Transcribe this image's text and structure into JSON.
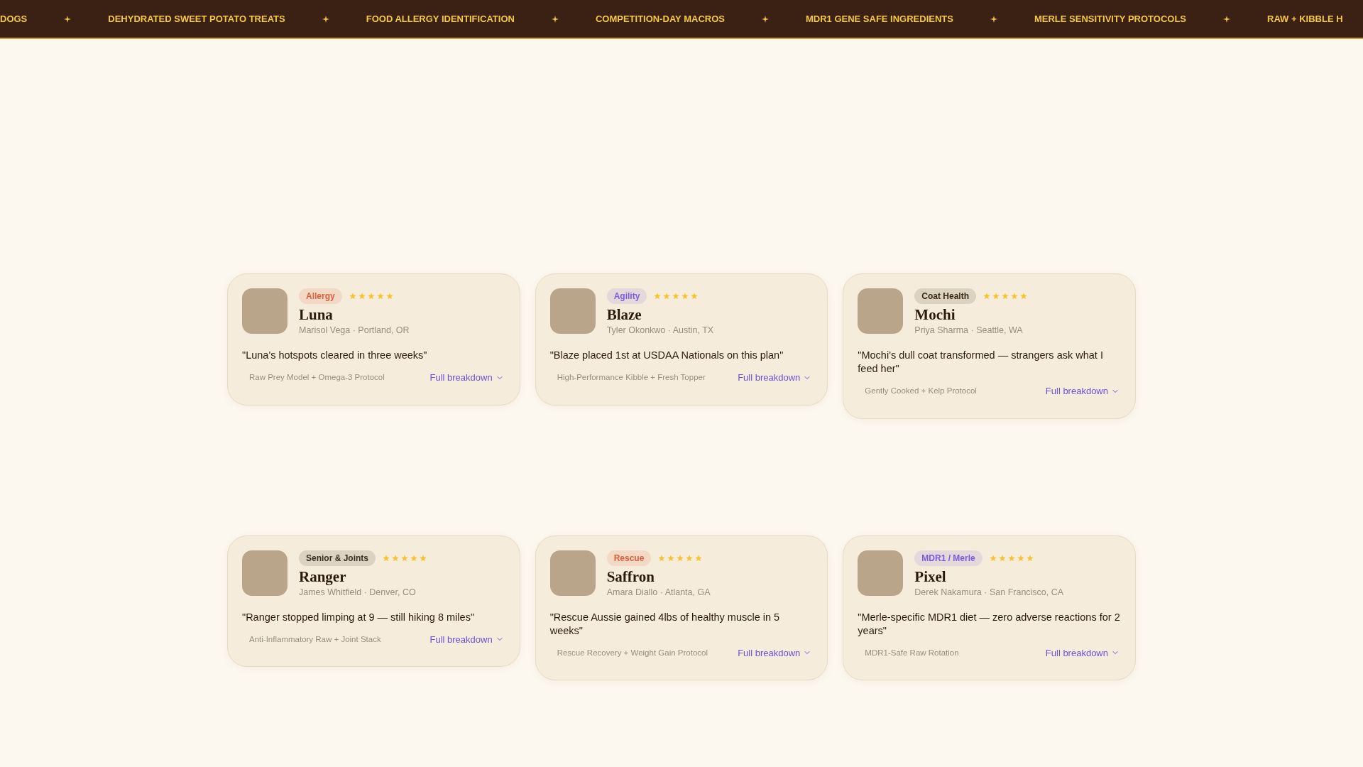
{
  "ticker": [
    "DOGS",
    "DEHYDRATED SWEET POTATO TREATS",
    "FOOD ALLERGY IDENTIFICATION",
    "COMPETITION-DAY MACROS",
    "MDR1 GENE SAFE INGREDIENTS",
    "MERLE SENSITIVITY PROTOCOLS",
    "RAW + KIBBLE H"
  ],
  "testimonials": [
    {
      "tag": {
        "label": "Allergy",
        "color": "#d9603b"
      },
      "stars": 5,
      "name": "Luna",
      "owner": "Marisol Vega · Portland, OR",
      "quote": "\"Luna's hotspots cleared in three weeks\"",
      "plan": "Raw Prey Model + Omega-3 Protocol",
      "link": "Full breakdown"
    },
    {
      "tag": {
        "label": "Agility",
        "color": "#7b5ce0"
      },
      "stars": 5,
      "name": "Blaze",
      "owner": "Tyler Okonkwo · Austin, TX",
      "quote": "\"Blaze placed 1st at USDAA Nationals on this plan\"",
      "plan": "High-Performance Kibble + Fresh Topper",
      "link": "Full breakdown"
    },
    {
      "tag": {
        "label": "Coat Health",
        "color": "#3a2a14"
      },
      "stars": 5,
      "name": "Mochi",
      "owner": "Priya Sharma · Seattle, WA",
      "quote": "\"Mochi's dull coat transformed — strangers ask what I feed her\"",
      "plan": "Gently Cooked + Kelp Protocol",
      "link": "Full breakdown"
    },
    {
      "tag": {
        "label": "Senior & Joints",
        "color": "#3a2e22"
      },
      "stars": 5,
      "name": "Ranger",
      "owner": "James Whitfield · Denver, CO",
      "quote": "\"Ranger stopped limping at 9 — still hiking 8 miles\"",
      "plan": "Anti-Inflammatory Raw + Joint Stack",
      "link": "Full breakdown"
    },
    {
      "tag": {
        "label": "Rescue",
        "color": "#d9603b"
      },
      "stars": 5,
      "name": "Saffron",
      "owner": "Amara Diallo · Atlanta, GA",
      "quote": "\"Rescue Aussie gained 4lbs of healthy muscle in 5 weeks\"",
      "plan": "Rescue Recovery + Weight Gain Protocol",
      "link": "Full breakdown"
    },
    {
      "tag": {
        "label": "MDR1 / Merle",
        "color": "#7b5ce0"
      },
      "stars": 5,
      "name": "Pixel",
      "owner": "Derek Nakamura · San Francisco, CA",
      "quote": "\"Merle-specific MDR1 diet — zero adverse reactions for 2 years\"",
      "plan": "MDR1-Safe Raw Rotation",
      "link": "Full breakdown"
    }
  ]
}
